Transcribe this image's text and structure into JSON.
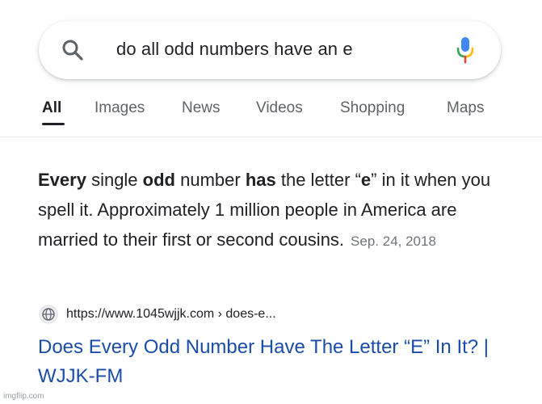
{
  "search": {
    "query": "do all odd numbers have an e"
  },
  "tabs": [
    {
      "label": "All",
      "active": true
    },
    {
      "label": "Images",
      "active": false
    },
    {
      "label": "News",
      "active": false
    },
    {
      "label": "Videos",
      "active": false
    },
    {
      "label": "Shopping",
      "active": false
    },
    {
      "label": "Maps",
      "active": false
    }
  ],
  "snippet": {
    "segments": [
      {
        "text": "Every",
        "bold": true
      },
      {
        "text": " single ",
        "bold": false
      },
      {
        "text": "odd",
        "bold": true
      },
      {
        "text": " number ",
        "bold": false
      },
      {
        "text": "has",
        "bold": true
      },
      {
        "text": " the letter “",
        "bold": false
      },
      {
        "text": "e",
        "bold": true
      },
      {
        "text": "” in it when you spell it. Approximately 1 million people in America are married to their first or second cousins.",
        "bold": false
      }
    ],
    "date": "Sep. 24, 2018"
  },
  "result": {
    "url": "https://www.1045wjjk.com › does-e...",
    "title": "Does Every Odd Number Have The Letter “E” In It? | WJJK-FM"
  },
  "watermark": "imgflip.com",
  "colors": {
    "link": "#1a4da8",
    "mic_blue": "#4285f4",
    "mic_red": "#ea4335",
    "mic_yellow": "#fbbc05",
    "mic_green": "#34a853"
  },
  "icons": {
    "search": "search-icon",
    "mic": "microphone-icon",
    "globe": "globe-icon"
  }
}
